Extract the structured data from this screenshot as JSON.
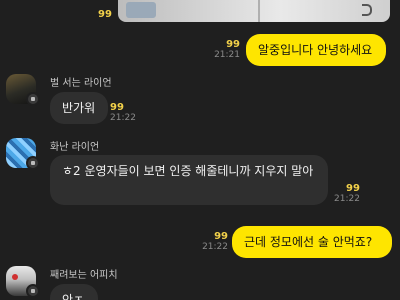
{
  "messages": {
    "m1": {
      "count": "99"
    },
    "m2": {
      "text": "알중입니다 안녕하세요",
      "count": "99",
      "time": "21:21"
    },
    "m3": {
      "sender": "벌 서는 라이언",
      "text": "반가워",
      "count": "99",
      "time": "21:22"
    },
    "m4": {
      "sender": "화난 라이언",
      "text": "ㅎ2 운영자들이 보면 인증 해줄테니까 지우지 말아",
      "count": "99",
      "time": "21:22"
    },
    "m5": {
      "text": "근데 정모에선 술 안먹죠?",
      "count": "99",
      "time": "21:22"
    },
    "m6": {
      "sender": "째려보는 어피치",
      "text": "안ㅈ"
    }
  }
}
